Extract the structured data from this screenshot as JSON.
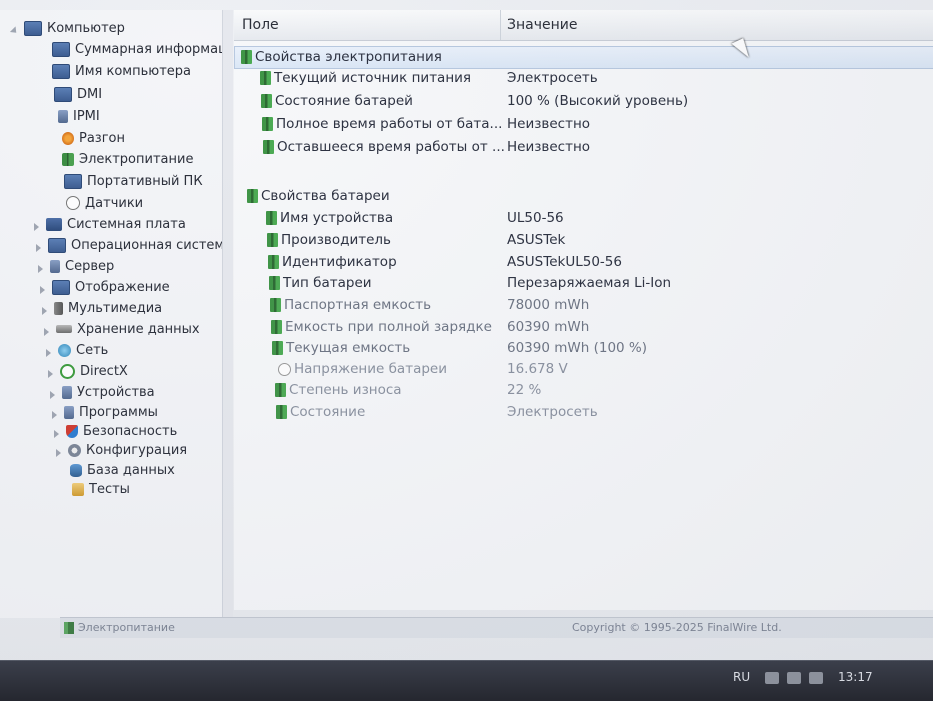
{
  "tree": {
    "items": [
      {
        "label": "Компьютер",
        "icon": "monitor-icon"
      },
      {
        "label": "Суммарная информац",
        "icon": "monitor-icon"
      },
      {
        "label": "Имя компьютера",
        "icon": "monitor-icon"
      },
      {
        "label": "DMI",
        "icon": "monitor-icon"
      },
      {
        "label": "IPMI",
        "icon": "pc-icon"
      },
      {
        "label": "Разгон",
        "icon": "overclock-icon"
      },
      {
        "label": "Электропитание",
        "icon": "battery-icon"
      },
      {
        "label": "Портативный ПК",
        "icon": "monitor-icon"
      },
      {
        "label": "Датчики",
        "icon": "gauge-icon"
      },
      {
        "label": "Системная плата",
        "icon": "motherboard-icon"
      },
      {
        "label": "Операционная система",
        "icon": "os-icon"
      },
      {
        "label": "Сервер",
        "icon": "server-icon"
      },
      {
        "label": "Отображение",
        "icon": "display-icon"
      },
      {
        "label": "Мультимедиа",
        "icon": "multimedia-icon"
      },
      {
        "label": "Хранение данных",
        "icon": "storage-icon"
      },
      {
        "label": "Сеть",
        "icon": "network-icon"
      },
      {
        "label": "DirectX",
        "icon": "directx-icon"
      },
      {
        "label": "Устройства",
        "icon": "devices-icon"
      },
      {
        "label": "Программы",
        "icon": "programs-icon"
      },
      {
        "label": "Безопасность",
        "icon": "security-icon"
      },
      {
        "label": "Конфигурация",
        "icon": "configuration-icon"
      },
      {
        "label": "База данных",
        "icon": "database-icon"
      },
      {
        "label": "Тесты",
        "icon": "tests-icon"
      }
    ]
  },
  "grid": {
    "col_field": "Поле",
    "col_value": "Значение",
    "rows": [
      {
        "field": "Свойства электропитания",
        "value": ""
      },
      {
        "field": "Текущий источник питания",
        "value": "Электросеть"
      },
      {
        "field": "Состояние батарей",
        "value": "100 % (Высокий уровень)"
      },
      {
        "field": "Полное время работы от бата...",
        "value": "Неизвестно"
      },
      {
        "field": "Оставшееся время работы от ...",
        "value": "Неизвестно"
      },
      {
        "field": "Свойства батареи",
        "value": ""
      },
      {
        "field": "Имя устройства",
        "value": "UL50-56"
      },
      {
        "field": "Производитель",
        "value": "ASUSTek"
      },
      {
        "field": "Идентификатор",
        "value": "ASUSTekUL50-56"
      },
      {
        "field": "Тип батареи",
        "value": "Перезаряжаемая Li-Ion"
      },
      {
        "field": "Паспортная емкость",
        "value": "78000 mWh"
      },
      {
        "field": "Емкость при полной зарядке",
        "value": "60390 mWh"
      },
      {
        "field": "Текущая емкость",
        "value": "60390 mWh  (100 %)"
      },
      {
        "field": "Напряжение батареи",
        "value": "16.678 V"
      },
      {
        "field": "Степень износа",
        "value": "22 %"
      },
      {
        "field": "Состояние",
        "value": "Электросеть"
      }
    ]
  },
  "status": {
    "left": "Электропитание",
    "right": "Copyright © 1995-2025 FinalWire Ltd."
  },
  "taskbar": {
    "lang": "RU",
    "clock": "13:17"
  }
}
